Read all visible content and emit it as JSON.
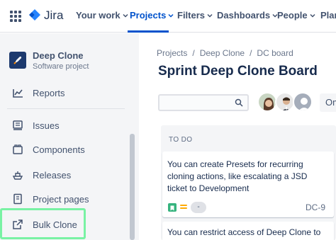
{
  "topbar": {
    "app_name": "Jira",
    "nav": [
      {
        "label": "Your work"
      },
      {
        "label": "Projects"
      },
      {
        "label": "Filters"
      },
      {
        "label": "Dashboards"
      },
      {
        "label": "People"
      },
      {
        "label": "Plan"
      }
    ],
    "active_nav": "Projects",
    "accent_color": "#0052cc"
  },
  "sidebar": {
    "project_name": "Deep Clone",
    "project_type": "Software project",
    "items": [
      {
        "label": "Reports",
        "icon": "chart-line-icon"
      },
      {
        "label": "Issues",
        "icon": "issues-list-icon"
      },
      {
        "label": "Components",
        "icon": "component-icon"
      },
      {
        "label": "Releases",
        "icon": "ship-icon"
      },
      {
        "label": "Project pages",
        "icon": "page-icon"
      },
      {
        "label": "Bulk Clone",
        "icon": "external-link-icon"
      }
    ],
    "highlight_color": "#79f2a4"
  },
  "breadcrumb": [
    "Projects",
    "Deep Clone",
    "DC board"
  ],
  "board": {
    "title": "Sprint Deep Clone Board",
    "extra_button": "Om",
    "column": {
      "title": "TO DO",
      "cards": [
        {
          "text": "You can create Presets for recurring cloning actions, like escalating a JSD ticket to Development",
          "estimate": "-",
          "key": "DC-9"
        },
        {
          "text": "You can restrict access of Deep Clone to"
        }
      ]
    }
  }
}
